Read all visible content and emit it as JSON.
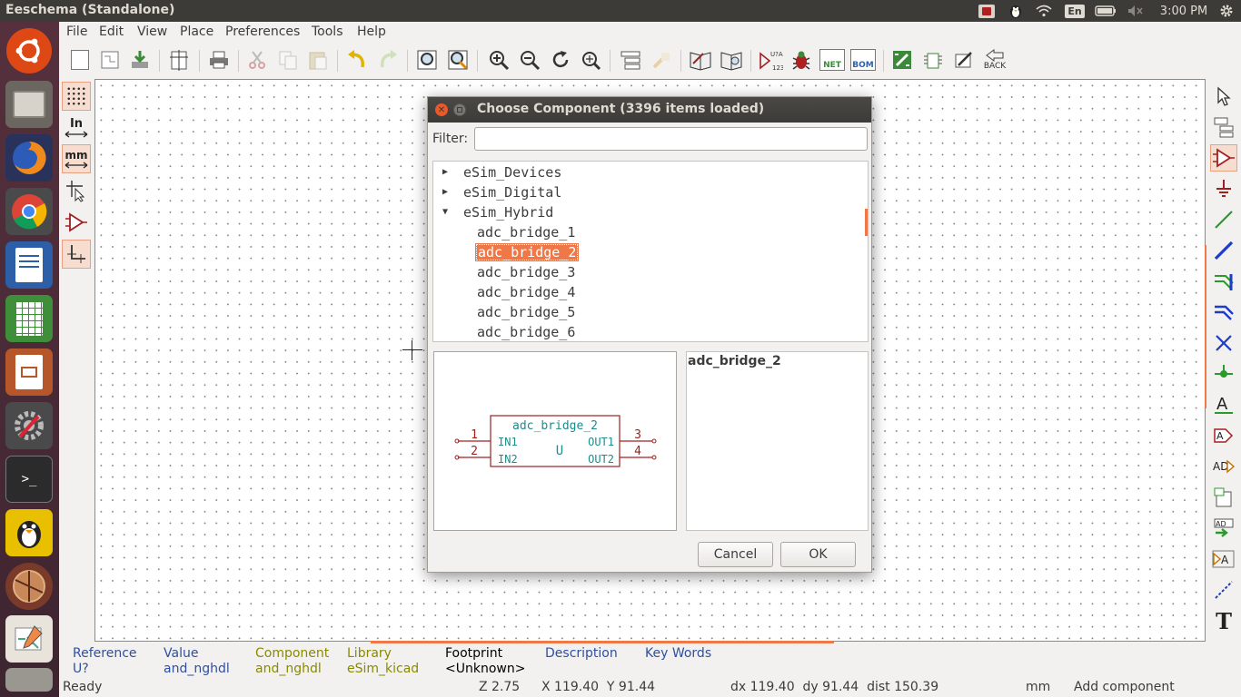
{
  "window": {
    "title": "Eeschema (Standalone)"
  },
  "tray": {
    "keyboard": "En",
    "time": "3:00 PM"
  },
  "menubar": [
    "File",
    "Edit",
    "View",
    "Place",
    "Preferences",
    "Tools",
    "Help"
  ],
  "toolbar": {
    "back_label": "BACK",
    "net_label": "NET",
    "bom_label": "BOM",
    "annotate_label": "U?A 123"
  },
  "left_toolbar": {
    "inch_label": "In",
    "mm_label": "mm"
  },
  "dialog": {
    "title": "Choose Component (3396 items loaded)",
    "filter_label": "Filter:",
    "filter_value": "",
    "tree": {
      "libraries": [
        "eSim_Devices",
        "eSim_Digital",
        "eSim_Hybrid"
      ],
      "children": [
        "adc_bridge_1",
        "adc_bridge_2",
        "adc_bridge_3",
        "adc_bridge_4",
        "adc_bridge_5",
        "adc_bridge_6"
      ],
      "selected": "adc_bridge_2"
    },
    "preview": {
      "name": "adc_bridge_2",
      "ref": "U",
      "pins_left": [
        {
          "num": "1",
          "name": "IN1"
        },
        {
          "num": "2",
          "name": "IN2"
        }
      ],
      "pins_right": [
        {
          "num": "3",
          "name": "OUT1"
        },
        {
          "num": "4",
          "name": "OUT2"
        }
      ]
    },
    "details_name": "adc_bridge_2",
    "cancel_label": "Cancel",
    "ok_label": "OK"
  },
  "infobar": [
    {
      "label": "Reference",
      "value": "U?",
      "color": "#2f4f9f"
    },
    {
      "label": "Value",
      "value": "and_nghdl",
      "color": "#2f4f9f"
    },
    {
      "label": "Component",
      "value": "and_nghdl",
      "color": "#8a8a00"
    },
    {
      "label": "Library",
      "value": "eSim_kicad",
      "color": "#8a8a00"
    },
    {
      "label": "Footprint",
      "value": "<Unknown>",
      "color": "#000000"
    },
    {
      "label": "Description",
      "value": "",
      "color": "#2f4f9f"
    },
    {
      "label": "Key Words",
      "value": "",
      "color": "#2f4f9f"
    }
  ],
  "status": {
    "ready": "Ready",
    "zoom": "Z 2.75",
    "coords": "X 119.40  Y 91.44",
    "delta": "dx 119.40  dy 91.44  dist 150.39",
    "units": "mm",
    "mode": "Add component"
  },
  "colors": {
    "accent": "#f07746",
    "schematic_line": "#a02020",
    "schematic_text": "#1e8c8c",
    "title_bar": "#3c3b37"
  }
}
